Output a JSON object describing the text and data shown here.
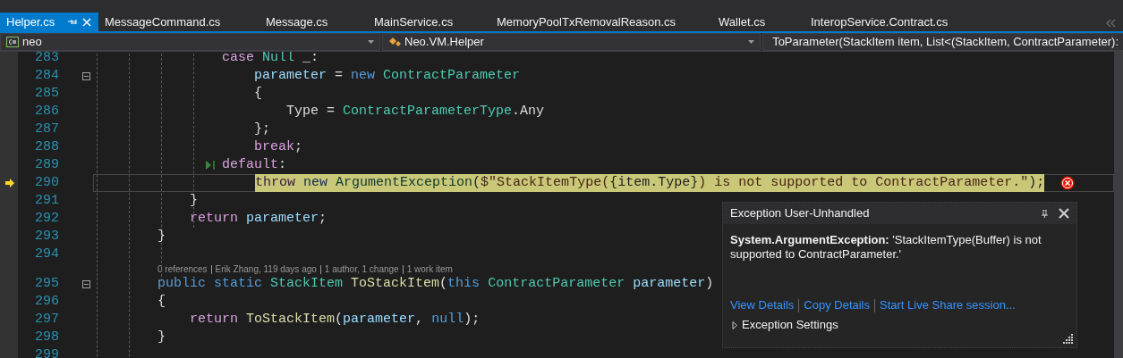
{
  "tabs": [
    {
      "label": "Helper.cs",
      "selected": true
    },
    {
      "label": "MessageCommand.cs",
      "selected": false
    },
    {
      "label": "Message.cs",
      "selected": false
    },
    {
      "label": "MainService.cs",
      "selected": false
    },
    {
      "label": "MemoryPoolTxRemovalReason.cs",
      "selected": false
    },
    {
      "label": "Wallet.cs",
      "selected": false
    },
    {
      "label": "InteropService.Contract.cs",
      "selected": false
    }
  ],
  "navigation_bar": {
    "project": "neo",
    "type": "Neo.VM.Helper",
    "member": "ToParameter(StackItem item, List<(StackItem, ContractParameter):"
  },
  "code_lines": [
    {
      "kind": "code",
      "number": "283",
      "current": false,
      "fold": false,
      "run_to_click": false,
      "error": false,
      "tokens": [
        {
          "kind": "control",
          "text": "                case "
        },
        {
          "kind": "type",
          "text": "Null"
        },
        {
          "kind": "plain",
          "text": " _:"
        }
      ]
    },
    {
      "kind": "code",
      "number": "284",
      "current": false,
      "fold": true,
      "run_to_click": false,
      "error": false,
      "tokens": [
        {
          "kind": "variable",
          "text": "                    parameter"
        },
        {
          "kind": "plain",
          "text": " = "
        },
        {
          "kind": "keyword",
          "text": "new "
        },
        {
          "kind": "type",
          "text": "ContractParameter"
        }
      ]
    },
    {
      "kind": "code",
      "number": "285",
      "current": false,
      "fold": false,
      "run_to_click": false,
      "error": false,
      "tokens": [
        {
          "kind": "plain",
          "text": "                    {"
        }
      ]
    },
    {
      "kind": "code",
      "number": "286",
      "current": false,
      "fold": false,
      "run_to_click": false,
      "error": false,
      "tokens": [
        {
          "kind": "plain",
          "text": "                        Type = "
        },
        {
          "kind": "type",
          "text": "ContractParameterType"
        },
        {
          "kind": "plain",
          "text": ".Any"
        }
      ]
    },
    {
      "kind": "code",
      "number": "287",
      "current": false,
      "fold": false,
      "run_to_click": false,
      "error": false,
      "tokens": [
        {
          "kind": "plain",
          "text": "                    };"
        }
      ]
    },
    {
      "kind": "code",
      "number": "288",
      "current": false,
      "fold": false,
      "run_to_click": false,
      "error": false,
      "tokens": [
        {
          "kind": "control",
          "text": "                    break"
        },
        {
          "kind": "plain",
          "text": ";"
        }
      ]
    },
    {
      "kind": "code",
      "number": "289",
      "current": false,
      "fold": false,
      "run_to_click": true,
      "error": false,
      "tokens": [
        {
          "kind": "control",
          "text": "                default"
        },
        {
          "kind": "plain",
          "text": ":"
        }
      ]
    },
    {
      "kind": "code",
      "number": "290",
      "current": true,
      "fold": false,
      "run_to_click": false,
      "error": true,
      "tokens": [
        {
          "kind": "control",
          "text": "                    throw "
        },
        {
          "kind": "keyword",
          "text": "new "
        },
        {
          "kind": "type",
          "text": "ArgumentException"
        },
        {
          "kind": "plain",
          "text": "("
        },
        {
          "kind": "string",
          "text": "$\"StackItemType("
        },
        {
          "kind": "plain",
          "text": "{item.Type}"
        },
        {
          "kind": "string",
          "text": ") is not supported to ContractParameter.\""
        },
        {
          "kind": "plain",
          "text": ");"
        }
      ]
    },
    {
      "kind": "code",
      "number": "291",
      "current": false,
      "fold": false,
      "run_to_click": false,
      "error": false,
      "tokens": [
        {
          "kind": "plain",
          "text": "            }"
        }
      ]
    },
    {
      "kind": "code",
      "number": "292",
      "current": false,
      "fold": false,
      "run_to_click": false,
      "error": false,
      "tokens": [
        {
          "kind": "control",
          "text": "            return "
        },
        {
          "kind": "variable",
          "text": "parameter"
        },
        {
          "kind": "plain",
          "text": ";"
        }
      ]
    },
    {
      "kind": "code",
      "number": "293",
      "current": false,
      "fold": false,
      "run_to_click": false,
      "error": false,
      "tokens": [
        {
          "kind": "plain",
          "text": "        }"
        }
      ]
    },
    {
      "kind": "code",
      "number": "294",
      "current": false,
      "fold": false,
      "run_to_click": false
    },
    {
      "kind": "codelens",
      "items": [
        "0 references",
        "Erik Zhang, 119 days ago",
        "1 author, 1 change",
        "1 work item"
      ]
    },
    {
      "kind": "code",
      "number": "295",
      "current": false,
      "fold": true,
      "run_to_click": false,
      "error": false,
      "tokens": [
        {
          "kind": "keyword",
          "text": "        public static "
        },
        {
          "kind": "type",
          "text": "StackItem "
        },
        {
          "kind": "method",
          "text": "ToStackItem"
        },
        {
          "kind": "plain",
          "text": "("
        },
        {
          "kind": "keyword",
          "text": "this "
        },
        {
          "kind": "type",
          "text": "ContractParameter "
        },
        {
          "kind": "variable",
          "text": "parameter"
        },
        {
          "kind": "plain",
          "text": ")"
        }
      ]
    },
    {
      "kind": "code",
      "number": "296",
      "current": false,
      "fold": false,
      "run_to_click": false,
      "error": false,
      "tokens": [
        {
          "kind": "plain",
          "text": "        {"
        }
      ]
    },
    {
      "kind": "code",
      "number": "297",
      "current": false,
      "fold": false,
      "run_to_click": false,
      "error": false,
      "tokens": [
        {
          "kind": "control",
          "text": "            return "
        },
        {
          "kind": "method",
          "text": "ToStackItem"
        },
        {
          "kind": "plain",
          "text": "("
        },
        {
          "kind": "variable",
          "text": "parameter"
        },
        {
          "kind": "plain",
          "text": ", "
        },
        {
          "kind": "keyword",
          "text": "null"
        },
        {
          "kind": "plain",
          "text": ");"
        }
      ]
    },
    {
      "kind": "code",
      "number": "298",
      "current": false,
      "fold": false,
      "run_to_click": false,
      "error": false,
      "tokens": [
        {
          "kind": "plain",
          "text": "        }"
        }
      ]
    },
    {
      "kind": "code",
      "number": "299",
      "current": false,
      "fold": false,
      "run_to_click": false
    }
  ],
  "exception_popup": {
    "title": "Exception User-Unhandled",
    "message": "**System.ArgumentException:** 'StackItemType(Buffer) is not supported to ContractParameter.'",
    "links": [
      "View Details",
      "Copy Details",
      "Start Live Share session..."
    ],
    "settings": {
      "label": "Exception Settings",
      "expanded": false
    }
  }
}
